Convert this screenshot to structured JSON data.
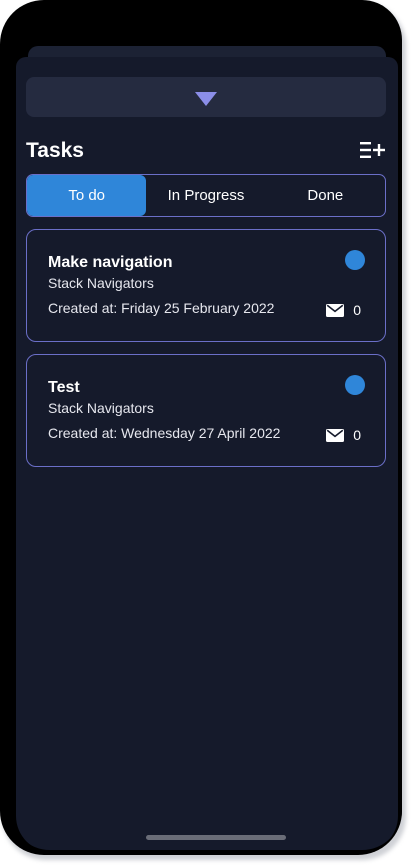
{
  "header": {
    "title": "Tasks",
    "add_icon": "add-list-icon",
    "collapse_icon": "chevron-down-icon"
  },
  "tabs": [
    {
      "label": "To do",
      "active": true
    },
    {
      "label": "In Progress",
      "active": false
    },
    {
      "label": "Done",
      "active": false
    }
  ],
  "tasks": [
    {
      "title": "Make navigation",
      "project": "Stack Navigators",
      "created": "Created at: Friday 25 February 2022",
      "messages": "0",
      "status_color": "#2f86d9"
    },
    {
      "title": "Test",
      "project": "Stack Navigators",
      "created": "Created at: Wednesday 27 April 2022",
      "messages": "0",
      "status_color": "#2f86d9"
    }
  ],
  "colors": {
    "background": "#151a2b",
    "accent": "#2f86d9",
    "border": "#6b6fc8"
  }
}
